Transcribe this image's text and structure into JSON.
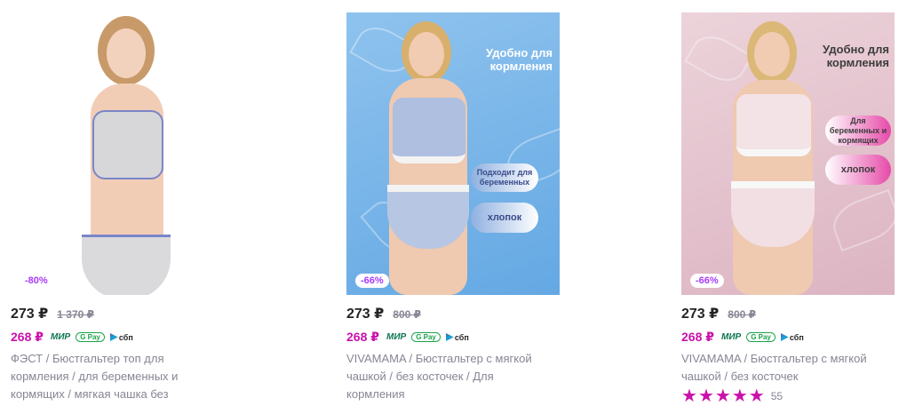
{
  "products": [
    {
      "discount": "-80%",
      "price": "273 ₽",
      "old_price": "1 370 ₽",
      "wallet_price": "268 ₽",
      "pay_mir": "МИР",
      "pay_gpay": "G Pay",
      "pay_sbp": "сбп",
      "brand": "ФЭСТ",
      "title_line": "ФЭСТ / Бюстгальтер топ для кормления / для беременных и кормящих / мягкая чашка без"
    },
    {
      "discount": "-66%",
      "price": "273 ₽",
      "old_price": "800 ₽",
      "wallet_price": "268 ₽",
      "pay_mir": "МИР",
      "pay_gpay": "G Pay",
      "pay_sbp": "сбп",
      "promo_title": "Удобно для кормления",
      "pill_1": "Подходит для беременных",
      "pill_2": "хлопок",
      "title_line": "VIVAMAMA / Бюстгальтер с мягкой чашкой / без косточек / Для кормления"
    },
    {
      "discount": "-66%",
      "price": "273 ₽",
      "old_price": "800 ₽",
      "wallet_price": "268 ₽",
      "pay_mir": "МИР",
      "pay_gpay": "G Pay",
      "pay_sbp": "сбп",
      "promo_title": "Удобно для кормления",
      "pill_1": "Для беременных и кормящих",
      "pill_2": "хлопок",
      "title_line": "VIVAMAMA / Бюстгальтер с мягкой чашкой / без косточек",
      "rating_stars": 5,
      "rating_count": "55"
    }
  ],
  "colors": {
    "accent": "#cb11ab",
    "discount": "#a73afd",
    "muted": "#868695"
  }
}
